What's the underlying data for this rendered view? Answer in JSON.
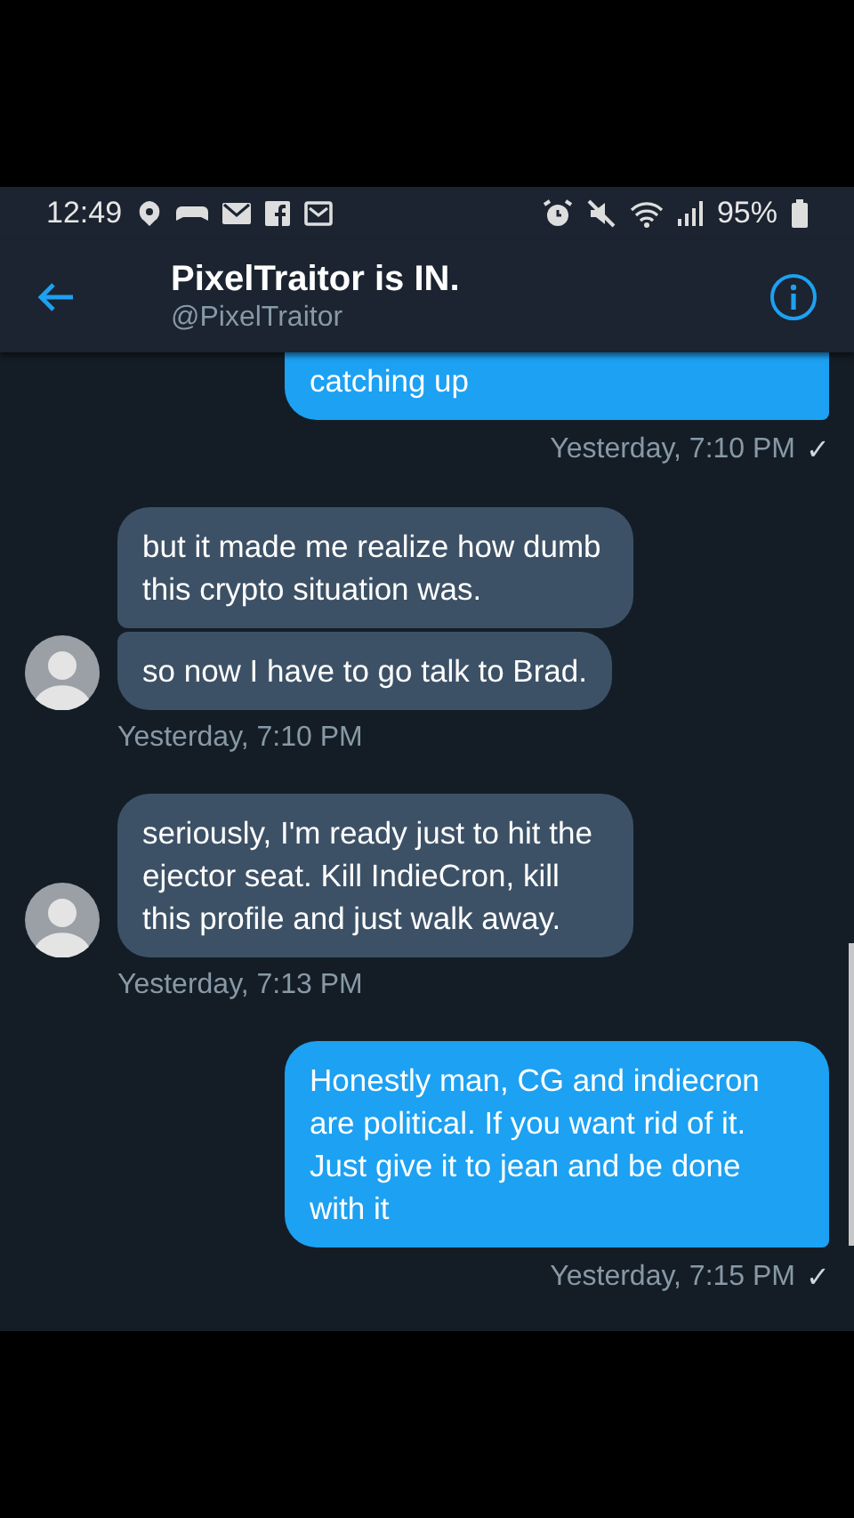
{
  "status_bar": {
    "time": "12:49",
    "battery": "95%"
  },
  "header": {
    "title": "PixelTraitor is IN.",
    "handle": "@PixelTraitor"
  },
  "messages": [
    {
      "kind": "sent",
      "bubbles": [
        "catching up"
      ],
      "time": "Yesterday, 7:10 PM",
      "receipt": "✓"
    },
    {
      "kind": "received",
      "bubbles": [
        "but it made me realize how dumb this crypto situation was.",
        "so now I have to go talk to Brad."
      ],
      "time": "Yesterday, 7:10 PM"
    },
    {
      "kind": "received",
      "bubbles": [
        "seriously, I'm ready just to hit the ejector seat. Kill IndieCron, kill this profile and just walk away."
      ],
      "time": "Yesterday, 7:13 PM"
    },
    {
      "kind": "sent",
      "bubbles": [
        "Honestly man, CG and indiecron are political. If you want rid of it. Just give it to jean and be done with it"
      ],
      "time": "Yesterday, 7:15 PM",
      "receipt": "✓"
    }
  ]
}
